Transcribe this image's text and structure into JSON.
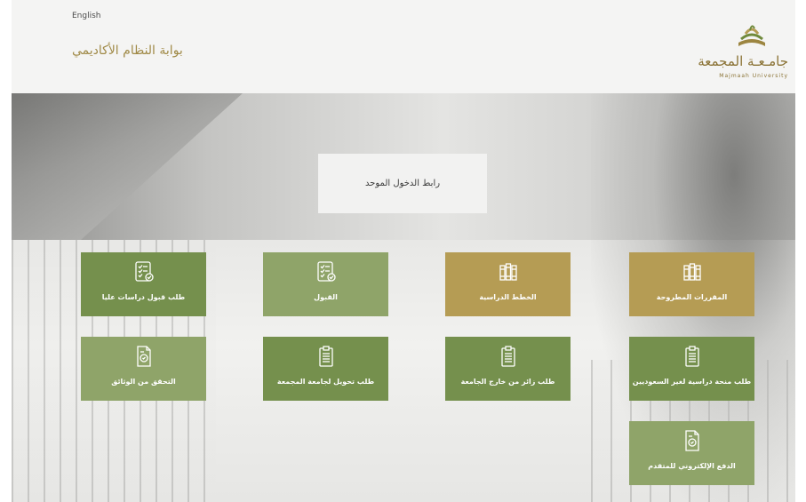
{
  "header": {
    "language_link": "English",
    "portal_title": "بوابة النظام الأكاديمي",
    "logo_arabic": "جامـعـة المجمعة",
    "logo_english": "Majmaah University"
  },
  "hero": {
    "sso_link": "رابط الدخول الموحد"
  },
  "tiles": [
    {
      "label": "المقررات المطروحة",
      "icon": "books-icon"
    },
    {
      "label": "الخطط الدراسية",
      "icon": "books-icon"
    },
    {
      "label": "القبول",
      "icon": "checklist-icon"
    },
    {
      "label": "طلب قبول دراسات عليا",
      "icon": "checklist-icon"
    },
    {
      "label": "طلب منحة دراسية لغير السعوديين",
      "icon": "clipboard-icon"
    },
    {
      "label": "طلب زائر من خارج الجامعة",
      "icon": "clipboard-icon"
    },
    {
      "label": "طلب تحويل لجامعة المجمعة",
      "icon": "clipboard-icon"
    },
    {
      "label": "التحقق من الوثائق",
      "icon": "document-verify-icon"
    },
    {
      "label": "الدفع الإلكتروني للمتقدم",
      "icon": "document-verify-icon"
    }
  ],
  "colors": {
    "gold": "#b59c54",
    "green_dark": "#75904d",
    "green_light": "#8fa469",
    "title_gold": "#a08a47"
  }
}
